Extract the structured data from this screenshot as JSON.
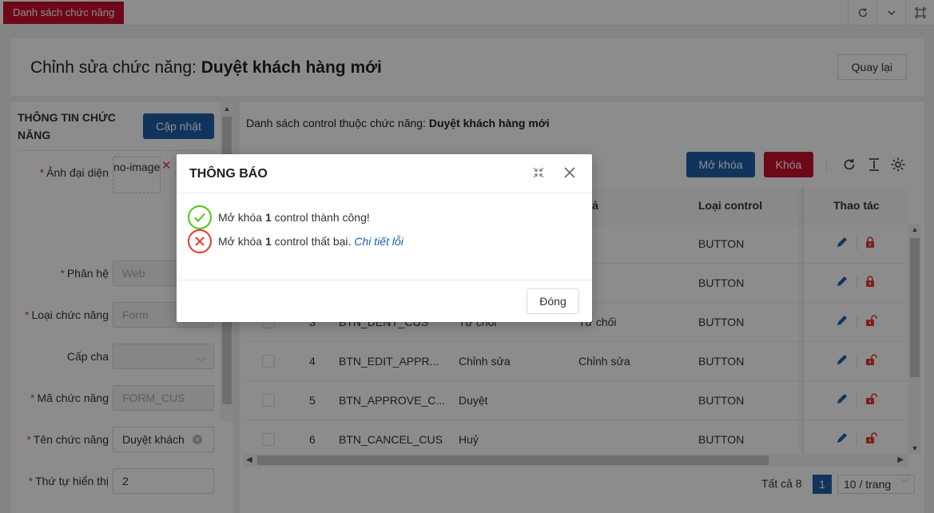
{
  "topbar": {
    "active_tab": "Danh sách chức năng",
    "icons": [
      "refresh-icon",
      "chevron-down-icon",
      "fullscreen-icon"
    ]
  },
  "header": {
    "title_prefix": "Chỉnh sửa chức năng:",
    "title_name": "Duyệt khách hàng mới",
    "back_label": "Quay lại"
  },
  "left": {
    "heading": "THÔNG TIN CHỨC NĂNG",
    "update_label": "Cập nhật",
    "avatar_label": "Ảnh đại diện",
    "avatar_value": "no-image",
    "fields": [
      {
        "label": "Phân hệ",
        "required": "*",
        "value": "Web"
      },
      {
        "label": "Loại chức năng",
        "required": "*",
        "value": "Form"
      },
      {
        "label": "Cấp cha",
        "required": "",
        "value": ""
      },
      {
        "label": "Mã chức năng",
        "required": "*",
        "value": "FORM_CUS"
      },
      {
        "label": "Tên chức năng",
        "required": "*",
        "value": "Duyệt khách"
      },
      {
        "label": "Thứ tự hiển thị",
        "required": "*",
        "value": "2"
      }
    ]
  },
  "right": {
    "title_prefix": "Danh sách control thuộc chức năng:",
    "title_name": "Duyệt khách hàng mới",
    "unlock_label": "Mở khóa",
    "lock_label": "Khóa",
    "columns": {
      "desc": "ô tả",
      "type": "Loại control",
      "actions": "Thao tác"
    },
    "rows": [
      {
        "num": "",
        "code": "",
        "name": "",
        "desc": "",
        "type": "BUTTON",
        "locked": true
      },
      {
        "num": "",
        "code": "",
        "name": "",
        "desc": "",
        "type": "BUTTON",
        "locked": true
      },
      {
        "num": "3",
        "code": "BTN_DENY_CUS",
        "name": "Từ chối",
        "desc": "Từ chối",
        "type": "BUTTON",
        "locked": false
      },
      {
        "num": "4",
        "code": "BTN_EDIT_APPR...",
        "name": "Chỉnh sửa",
        "desc": "Chỉnh sửa",
        "type": "BUTTON",
        "locked": false
      },
      {
        "num": "5",
        "code": "BTN_APPROVE_C...",
        "name": "Duyệt",
        "desc": "",
        "type": "BUTTON",
        "locked": false
      },
      {
        "num": "6",
        "code": "BTN_CANCEL_CUS",
        "name": "Huỷ",
        "desc": "",
        "type": "BUTTON",
        "locked": false
      }
    ],
    "pager": {
      "total": "Tất cả 8",
      "page": "1",
      "size": "10 / trang"
    }
  },
  "modal": {
    "title": "THÔNG BÁO",
    "success_pre": "Mở khóa",
    "success_count": "1",
    "success_post": "control thành công!",
    "fail_pre": "Mở khóa",
    "fail_count": "1",
    "fail_post": "control thất bại.",
    "fail_link": "Chi tiết lỗi",
    "close_label": "Đóng"
  },
  "colors": {
    "brand_red": "#c8102e",
    "primary_blue": "#1f5fa8",
    "success": "#52c41a",
    "danger": "#e53935"
  }
}
